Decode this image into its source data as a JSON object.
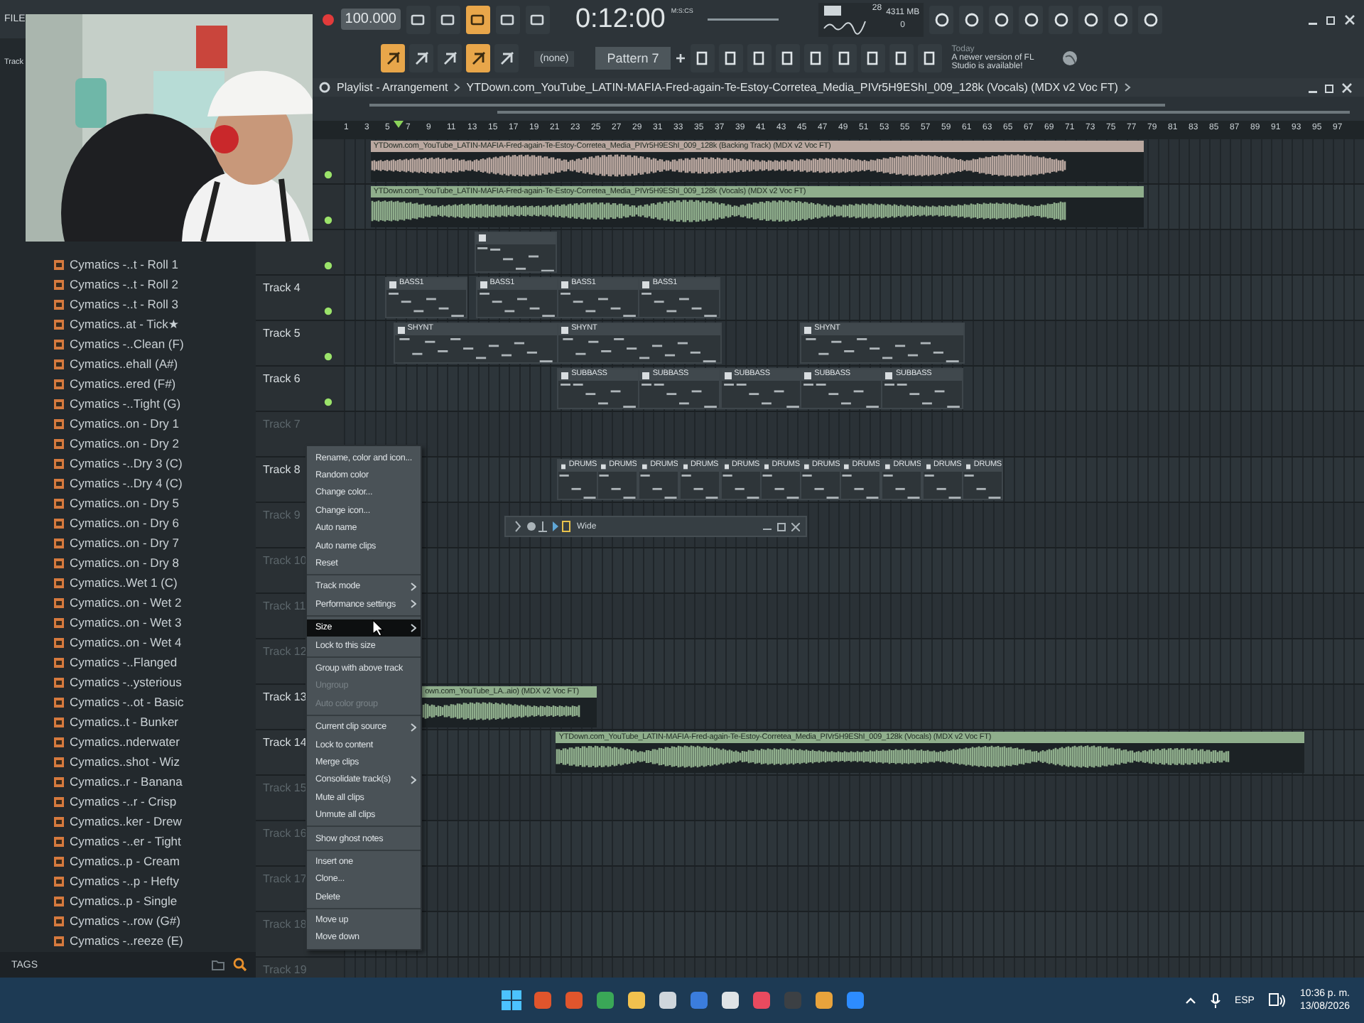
{
  "menu_bar": {
    "items": [
      "FILE"
    ]
  },
  "transport": {
    "tempo": "100.000",
    "time": "0:12:00",
    "time_unit": "M:S:CS",
    "cpu": "28",
    "memory": "4311 MB",
    "polyphony": "0",
    "toggles": [
      {
        "on": false
      },
      {
        "on": false
      },
      {
        "on": true
      },
      {
        "on": false
      },
      {
        "on": false
      }
    ]
  },
  "toolbar": {
    "toggles": [
      {
        "on": true
      },
      {
        "on": false
      },
      {
        "on": false
      },
      {
        "on": true
      },
      {
        "on": false
      }
    ],
    "snap": "(none)",
    "pattern": "Pattern 7",
    "news_day": "Today",
    "news": "A newer version of FL Studio is available!"
  },
  "browser": {
    "header": "Track",
    "items": [
      "Cymatics -..t - Roll 1",
      "Cymatics -..t - Roll 2",
      "Cymatics -..t - Roll 3",
      "Cymatics..at - Tick★",
      "Cymatics -..Clean (F)",
      "Cymatics..ehall (A#)",
      "Cymatics..ered (F#)",
      "Cymatics -..Tight (G)",
      "Cymatics..on - Dry 1",
      "Cymatics..on - Dry 2",
      "Cymatics -..Dry 3 (C)",
      "Cymatics -..Dry 4 (C)",
      "Cymatics..on - Dry 5",
      "Cymatics..on - Dry 6",
      "Cymatics..on - Dry 7",
      "Cymatics..on - Dry 8",
      "Cymatics..Wet 1 (C)",
      "Cymatics..on - Wet 2",
      "Cymatics..on - Wet 3",
      "Cymatics..on - Wet 4",
      "Cymatics -..Flanged",
      "Cymatics -..ysterious",
      "Cymatics -..ot - Basic",
      "Cymatics..t - Bunker",
      "Cymatics..nderwater",
      "Cymatics..shot - Wiz",
      "Cymatics..r - Banana",
      "Cymatics -..r - Crisp",
      "Cymatics..ker - Drew",
      "Cymatics -..er - Tight",
      "Cymatics..p - Cream",
      "Cymatics -..p - Hefty",
      "Cymatics..p - Single",
      "Cymatics -..row (G#)",
      "Cymatics -..reeze (E)"
    ],
    "footer": "TAGS"
  },
  "playlist": {
    "breadcrumb": [
      "Playlist - Arrangement",
      "YTDown.com_YouTube_LATIN-MAFIA-Fred-again-Te-Estoy-Corretea_Media_PIVr5H9EShI_009_128k (Vocals) (MDX v2 Voc FT)"
    ],
    "ruler": [
      "1",
      "3",
      "5",
      "7",
      "9",
      "11",
      "13",
      "15",
      "17",
      "19",
      "21",
      "23",
      "25",
      "27",
      "29",
      "31",
      "33",
      "35",
      "37",
      "39",
      "41",
      "43",
      "45",
      "47",
      "49",
      "51",
      "53",
      "55",
      "57",
      "59",
      "61",
      "63",
      "65",
      "67",
      "69",
      "71",
      "73",
      "75",
      "77",
      "79",
      "81",
      "83",
      "85",
      "87",
      "89",
      "91",
      "93",
      "95",
      "97"
    ],
    "tracks": [
      {
        "led": true,
        "clips": [
          {
            "kind": "audio",
            "label": "YTDown.com_YouTube_LATIN-MAFIA-Fred-again-Te-Estoy-Corretea_Media_PIVr5H9EShI_009_128k (Backing Track) (MDX v2 Voc FT)",
            "color": "#b9a79f"
          }
        ]
      },
      {
        "led": true,
        "clips": [
          {
            "kind": "audio",
            "label": "YTDown.com_YouTube_LATIN-MAFIA-Fred-again-Te-Estoy-Corretea_Media_PIVr5H9EShI_009_128k (Vocals) (MDX v2 Voc FT)",
            "color": "#8fae8c"
          }
        ]
      },
      {
        "led": true,
        "clips": [
          {
            "kind": "pattern"
          }
        ]
      },
      {
        "name": "Track 4",
        "has_content": true,
        "led": true,
        "clips": [
          {
            "kind": "pattern",
            "label": "BASS1"
          },
          {
            "kind": "pattern",
            "label": "BASS1"
          },
          {
            "kind": "pattern",
            "label": "BASS1"
          },
          {
            "kind": "pattern",
            "label": "BASS1"
          }
        ]
      },
      {
        "name": "Track 5",
        "has_content": true,
        "led": true,
        "clips": [
          {
            "kind": "pattern",
            "label": "SHYNT"
          },
          {
            "kind": "pattern",
            "label": "SHYNT"
          },
          {
            "kind": "pattern",
            "label": "SHYNT"
          }
        ]
      },
      {
        "name": "Track 6",
        "has_content": true,
        "led": true,
        "clips": [
          {
            "kind": "pattern",
            "label": "SUBBASS"
          },
          {
            "kind": "pattern",
            "label": "SUBBASS"
          },
          {
            "kind": "pattern",
            "label": "SUBBASS"
          },
          {
            "kind": "pattern",
            "label": "SUBBASS"
          },
          {
            "kind": "pattern",
            "label": "SUBBASS"
          }
        ]
      },
      {
        "name": "Track 7",
        "has_content": false,
        "led": false
      },
      {
        "name": "Track 8",
        "has_content": true,
        "led": false,
        "clips": [
          {
            "kind": "pattern",
            "label": "DRUMS"
          },
          {
            "kind": "pattern",
            "label": "DRUMS"
          },
          {
            "kind": "pattern",
            "label": "DRUMS"
          },
          {
            "kind": "pattern",
            "label": "DRUMS"
          },
          {
            "kind": "pattern",
            "label": "DRUMS"
          },
          {
            "kind": "pattern",
            "label": "DRUMS"
          },
          {
            "kind": "pattern",
            "label": "DRUMS"
          },
          {
            "kind": "pattern",
            "label": "DRUMS"
          },
          {
            "kind": "pattern",
            "label": "DRUMS"
          },
          {
            "kind": "pattern",
            "label": "DRUMS"
          },
          {
            "kind": "pattern",
            "label": "DRUMS"
          }
        ]
      },
      {
        "name": "Track 9",
        "has_content": false,
        "led": false
      },
      {
        "name": "Track 10",
        "has_content": false,
        "led": false
      },
      {
        "name": "Track 11",
        "has_content": false,
        "led": false
      },
      {
        "name": "Track 12",
        "has_content": false,
        "led": false
      },
      {
        "name": "Track 13",
        "has_content": true,
        "led": false,
        "clips": [
          {
            "kind": "audio",
            "label": "own.com_YouTube_LA..aio) (MDX v2 Voc FT)",
            "color": "#8fae8c"
          }
        ]
      },
      {
        "name": "Track 14",
        "has_content": true,
        "led": false,
        "clips": [
          {
            "kind": "audio",
            "label": "YTDown.com_YouTube_LATIN-MAFIA-Fred-again-Te-Estoy-Corretea_Media_PIVr5H9EShI_009_128k (Vocals) (MDX v2 Voc FT)",
            "color": "#8fae8c"
          }
        ]
      },
      {
        "name": "Track 15",
        "has_content": false,
        "led": false
      },
      {
        "name": "Track 16",
        "has_content": false,
        "led": false
      },
      {
        "name": "Track 17",
        "has_content": false,
        "led": false
      },
      {
        "name": "Track 18",
        "has_content": false,
        "led": false
      },
      {
        "name": "Track 19",
        "has_content": false,
        "led": false
      }
    ]
  },
  "context_menu": {
    "groups": [
      [
        {
          "label": "Rename, color and icon...",
          "disabled": false,
          "selected": false,
          "submenu": false
        },
        {
          "label": "Random color",
          "disabled": false,
          "selected": false,
          "submenu": false
        },
        {
          "label": "Change color...",
          "disabled": false,
          "selected": false,
          "submenu": false
        },
        {
          "label": "Change icon...",
          "disabled": false,
          "selected": false,
          "submenu": false
        },
        {
          "label": "Auto name",
          "disabled": false,
          "selected": false,
          "submenu": false
        },
        {
          "label": "Auto name clips",
          "disabled": false,
          "selected": false,
          "submenu": false
        },
        {
          "label": "Reset",
          "disabled": false,
          "selected": false,
          "submenu": false
        }
      ],
      [
        {
          "label": "Track mode",
          "disabled": false,
          "selected": false,
          "submenu": true
        },
        {
          "label": "Performance settings",
          "disabled": false,
          "selected": false,
          "submenu": true
        }
      ],
      [
        {
          "label": "Size",
          "disabled": false,
          "selected": true,
          "submenu": true
        },
        {
          "label": "Lock to this size",
          "disabled": false,
          "selected": false,
          "submenu": false
        }
      ],
      [
        {
          "label": "Group with above track",
          "disabled": false,
          "selected": false,
          "submenu": false
        },
        {
          "label": "Ungroup",
          "disabled": true,
          "selected": false,
          "submenu": false
        },
        {
          "label": "Auto color group",
          "disabled": true,
          "selected": false,
          "submenu": false
        }
      ],
      [
        {
          "label": "Current clip source",
          "disabled": false,
          "selected": false,
          "submenu": true
        },
        {
          "label": "Lock to content",
          "disabled": false,
          "selected": false,
          "submenu": false
        },
        {
          "label": "Merge clips",
          "disabled": false,
          "selected": false,
          "submenu": false
        },
        {
          "label": "Consolidate track(s)",
          "disabled": false,
          "selected": false,
          "submenu": true
        },
        {
          "label": "Mute all clips",
          "disabled": false,
          "selected": false,
          "submenu": false
        },
        {
          "label": "Unmute all clips",
          "disabled": false,
          "selected": false,
          "submenu": false
        }
      ],
      [
        {
          "label": "Show ghost notes",
          "disabled": false,
          "selected": false,
          "submenu": false
        }
      ],
      [
        {
          "label": "Insert one",
          "disabled": false,
          "selected": false,
          "submenu": false
        },
        {
          "label": "Clone...",
          "disabled": false,
          "selected": false,
          "submenu": false
        },
        {
          "label": "Delete",
          "disabled": false,
          "selected": false,
          "submenu": false
        }
      ],
      [
        {
          "label": "Move up",
          "disabled": false,
          "selected": false,
          "submenu": false
        },
        {
          "label": "Move down",
          "disabled": false,
          "selected": false,
          "submenu": false
        }
      ]
    ]
  },
  "floating_window": {
    "title": "Wide"
  },
  "taskbar": {
    "language": "ESP",
    "time": "10:36 p. m.",
    "date": "13/08/2026"
  }
}
